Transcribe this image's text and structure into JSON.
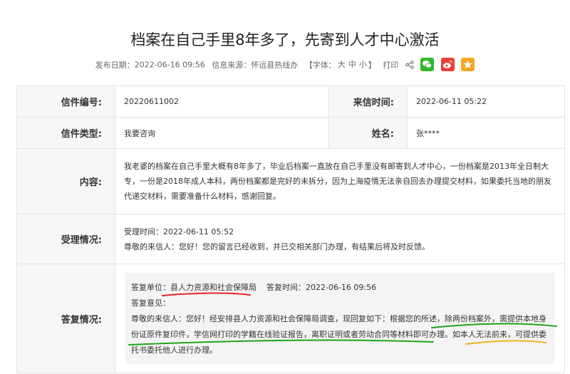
{
  "article": {
    "title": "档案在自己手里8年多了，先寄到人才中心激活",
    "publish_label": "发布日期：",
    "publish_date": "2022-06-16 09:56",
    "source_label": "信息来源：",
    "source": "怀远县热线办",
    "font_label_open": "【字体：",
    "font_large": "大",
    "font_medium": "中",
    "font_small": "小",
    "font_label_close": "】",
    "print_label": "打印",
    "icons": [
      "share-icon",
      "wechat-icon",
      "weibo-icon",
      "favorite-icon"
    ]
  },
  "letter": {
    "number_label": "信件编号:",
    "number": "20220611002",
    "time_label": "来信时间:",
    "time": "2022-06-11 05:22",
    "type_label": "信件类型:",
    "type": "我要咨询",
    "name_label": "姓名:",
    "name": "张****",
    "content_label": "内容:",
    "content": "我老婆的档案在自己手里大概有8年多了，毕业后档案一直放在自己手里没有邮寄到人才中心，一份档案是2013年全日制大专，一份是2018年成人本科，两份档案都是完好的未拆分，因为上海疫情无法亲自回去办理提交材料，如果委托当地的朋友代递交材料，需要准备什么材料，感谢回复。",
    "accept_label": "受理情况:",
    "accept_time": "受理时间：2022-06-11 05:52",
    "accept_text": "尊敬的来信人：您好！您的留言已经收到，并已交相关部门办理，有结果后将及时反馈。",
    "reply_label": "答复情况:",
    "reply_unit_label": "答复单位：",
    "reply_unit": "县人力资源和社会保障局",
    "reply_time_label": "答复时间：",
    "reply_time": "2022-06-16 09:56",
    "reply_opinion_label": "答复意见：",
    "reply_text": "尊敬的来信人：您好！经安排县人力资源和社会保障局调查，现回复如下：根据您的所述，除两份档案外，需提供本地身份证原件复印件，学信网打印的学籍在线验证报告，离职证明或者劳动合同等材料即可办理。如本人无法前来，可提供委托书委托他人进行办理。"
  },
  "colors": {
    "label_bg": "#f7f7f7",
    "reply_bg": "#f4f4f4",
    "wechat": "#35b72d",
    "weibo": "#e8413c",
    "favorite": "#f6a623",
    "mark_red": "#e52525",
    "mark_green": "#1fa51a",
    "mark_orange": "#f2b11f"
  }
}
